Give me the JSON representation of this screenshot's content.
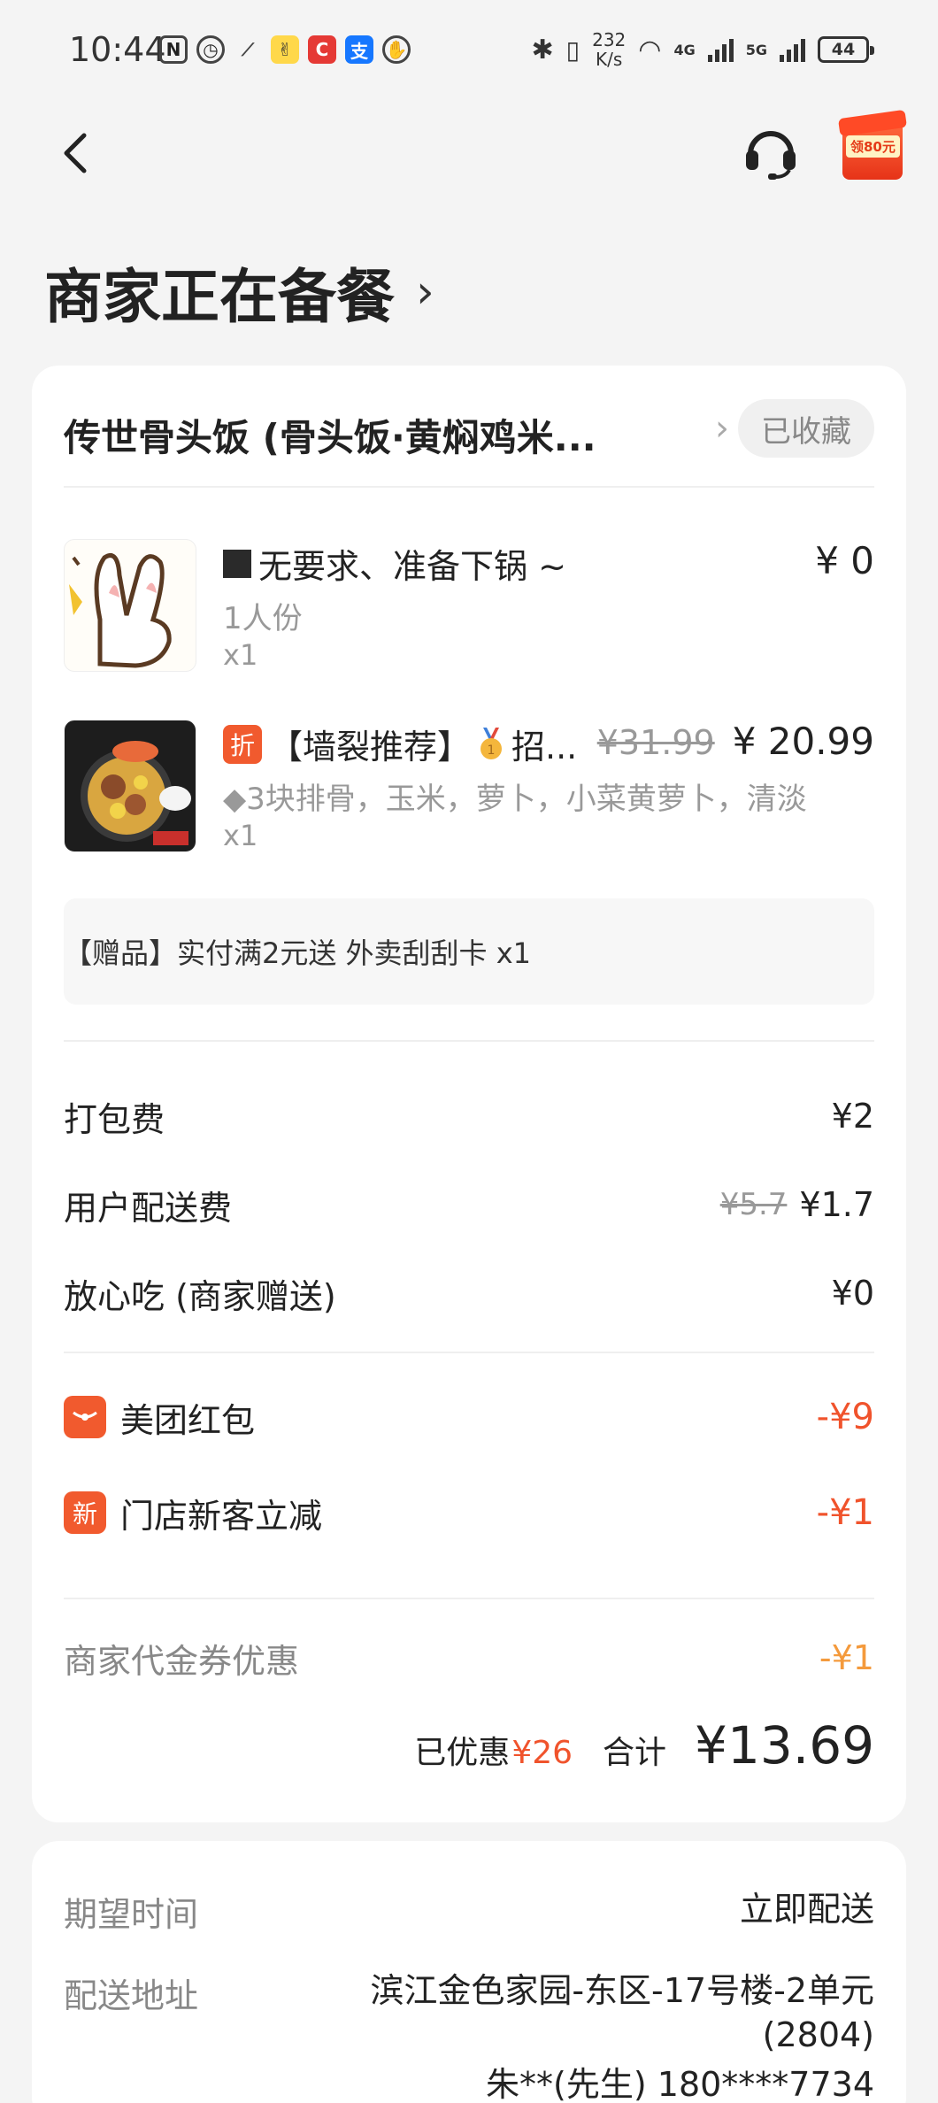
{
  "status_bar": {
    "time": "10:44",
    "speed_top": "232",
    "speed_bottom": "K/s",
    "net1": "4G",
    "net2": "5G",
    "battery": "44"
  },
  "nav": {
    "coupon_label": "领80元"
  },
  "header": {
    "title": "商家正在备餐"
  },
  "shop": {
    "name": "传世骨头饭 (骨头饭·黄焖鸡米...",
    "favorite_label": "已收藏"
  },
  "items": [
    {
      "title": "无要求、准备下锅 ~",
      "price": "¥ 0",
      "spec": "1人份",
      "qty": "x1"
    },
    {
      "title": "【墙裂推荐】",
      "title_suffix": "招...",
      "badge": "折",
      "old_price": "¥31.99",
      "price": "¥ 20.99",
      "spec": "◆3块排骨，玉米，萝卜，小菜黄萝卜，清淡",
      "qty": "x1"
    }
  ],
  "gift": {
    "text": "【赠品】实付满2元送 外卖刮刮卡 x1"
  },
  "fees": {
    "packing_label": "打包费",
    "packing_value": "¥2",
    "delivery_label": "用户配送费",
    "delivery_old": "¥5.7",
    "delivery_value": "¥1.7",
    "assurance_label": "放心吃 (商家赠送)",
    "assurance_value": "¥0"
  },
  "promos": {
    "redpacket_label": "美团红包",
    "redpacket_value": "-¥9",
    "newcustomer_icon": "新",
    "newcustomer_label": "门店新客立减",
    "newcustomer_value": "-¥1",
    "voucher_label": "商家代金券优惠",
    "voucher_value": "-¥1"
  },
  "summary": {
    "saved_label": "已优惠",
    "saved_value": "¥26",
    "total_label": "合计",
    "total_value": "¥13.69"
  },
  "delivery": {
    "time_label": "期望时间",
    "time_value": "立即配送",
    "address_label": "配送地址",
    "address_line1": "滨江金色家园-东区-17号楼-2单元",
    "address_line2": "(2804)",
    "contact": "朱**(先生) 180****7734"
  },
  "colors": {
    "accent_red": "#f0532c",
    "accent_orange": "#f49a3c",
    "background": "#f4f4f4"
  }
}
